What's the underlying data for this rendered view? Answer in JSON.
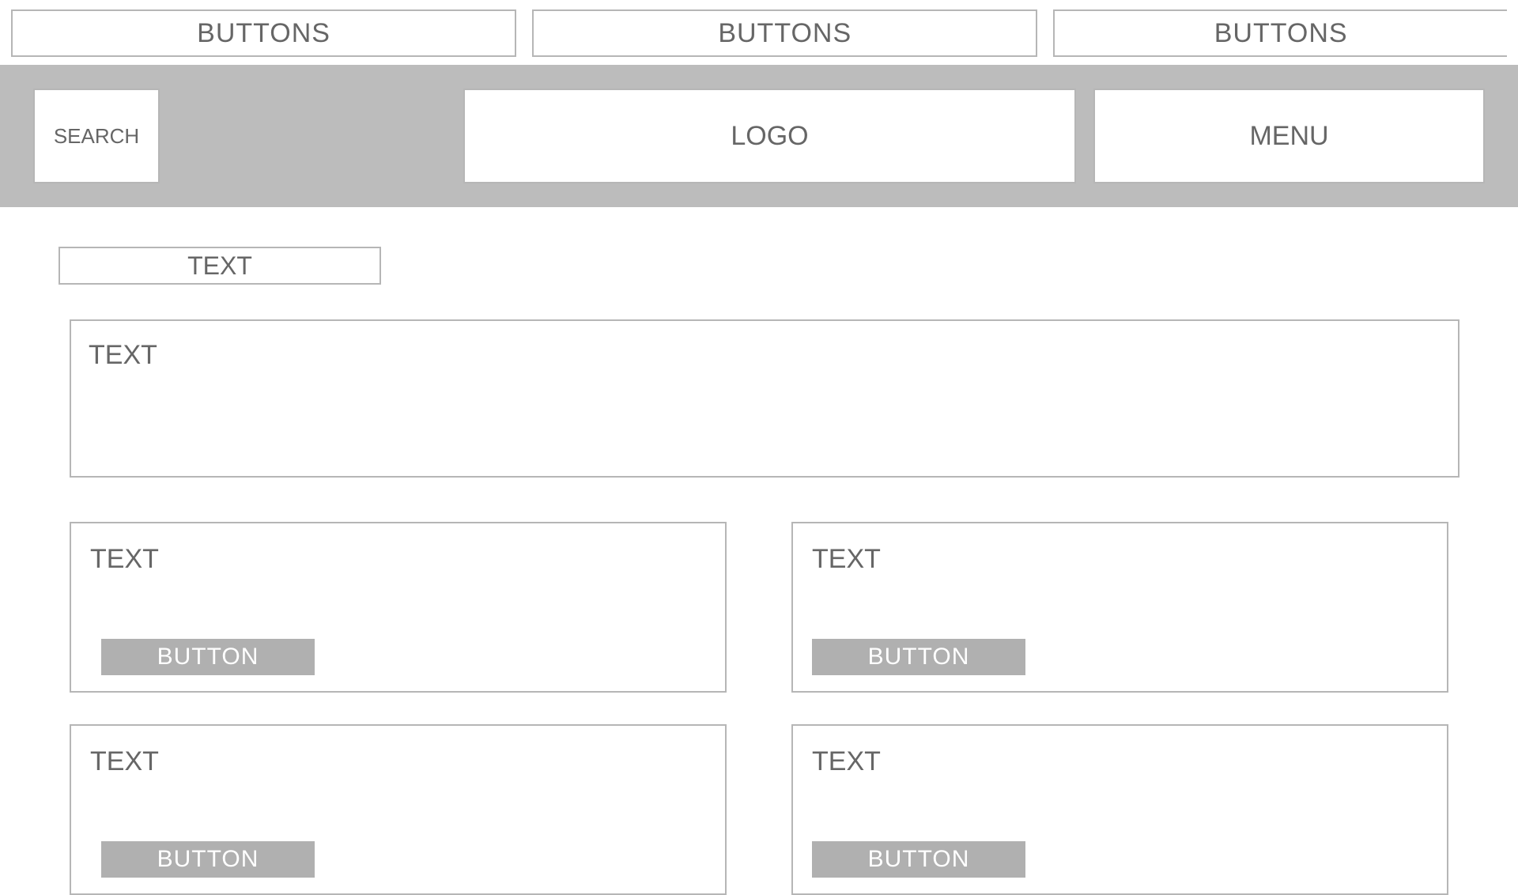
{
  "top_buttons": {
    "btn1": "BUTTONS",
    "btn2": "BUTTONS",
    "btn3": "BUTTONS"
  },
  "header": {
    "search": "SEARCH",
    "logo": "LOGO",
    "menu": "MENU"
  },
  "content": {
    "small_text": "TEXT",
    "wide_text": "TEXT"
  },
  "cards": [
    {
      "text": "TEXT",
      "button": "BUTTON"
    },
    {
      "text": "TEXT",
      "button": "BUTTON"
    },
    {
      "text": "TEXT",
      "button": "BUTTON"
    },
    {
      "text": "TEXT",
      "button": "BUTTON"
    }
  ]
}
